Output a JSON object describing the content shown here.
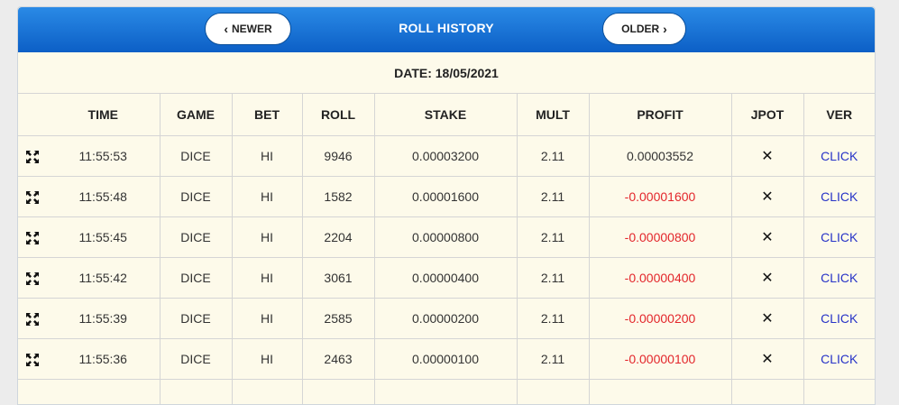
{
  "header": {
    "title": "ROLL HISTORY",
    "newer_label": "NEWER",
    "older_label": "OLDER"
  },
  "date_label": "DATE: 18/05/2021",
  "columns": [
    "TIME",
    "GAME",
    "BET",
    "ROLL",
    "STAKE",
    "MULT",
    "PROFIT",
    "JPOT",
    "VER"
  ],
  "rows": [
    {
      "time": "11:55:53",
      "game": "DICE",
      "bet": "HI",
      "roll": "9946",
      "stake": "0.00003200",
      "mult": "2.11",
      "profit": "0.00003552",
      "jpot": "✕",
      "ver": "CLICK"
    },
    {
      "time": "11:55:48",
      "game": "DICE",
      "bet": "HI",
      "roll": "1582",
      "stake": "0.00001600",
      "mult": "2.11",
      "profit": "-0.00001600",
      "jpot": "✕",
      "ver": "CLICK"
    },
    {
      "time": "11:55:45",
      "game": "DICE",
      "bet": "HI",
      "roll": "2204",
      "stake": "0.00000800",
      "mult": "2.11",
      "profit": "-0.00000800",
      "jpot": "✕",
      "ver": "CLICK"
    },
    {
      "time": "11:55:42",
      "game": "DICE",
      "bet": "HI",
      "roll": "3061",
      "stake": "0.00000400",
      "mult": "2.11",
      "profit": "-0.00000400",
      "jpot": "✕",
      "ver": "CLICK"
    },
    {
      "time": "11:55:39",
      "game": "DICE",
      "bet": "HI",
      "roll": "2585",
      "stake": "0.00000200",
      "mult": "2.11",
      "profit": "-0.00000200",
      "jpot": "✕",
      "ver": "CLICK"
    },
    {
      "time": "11:55:36",
      "game": "DICE",
      "bet": "HI",
      "roll": "2463",
      "stake": "0.00000100",
      "mult": "2.11",
      "profit": "-0.00000100",
      "jpot": "✕",
      "ver": "CLICK"
    },
    {
      "time": "",
      "game": "",
      "bet": "",
      "roll": "",
      "stake": "",
      "mult": "",
      "profit": "",
      "jpot": "",
      "ver": ""
    }
  ],
  "colors": {
    "header_top": "#2a8ae6",
    "header_bottom": "#0c5fc6",
    "panel_bg": "#fdfaea",
    "profit_negative": "#e3262b",
    "link": "#2733c7"
  },
  "icons": {
    "row_icon": "expand-arrows-icon",
    "newer_icon": "chevron-left-icon",
    "older_icon": "chevron-right-icon"
  }
}
